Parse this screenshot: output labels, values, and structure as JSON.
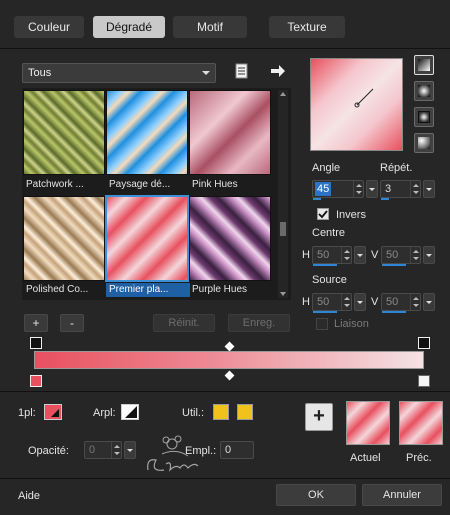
{
  "tabs": [
    {
      "label": "Couleur",
      "active": false
    },
    {
      "label": "Dégradé",
      "active": true
    },
    {
      "label": "Motif",
      "active": false
    },
    {
      "label": "Texture",
      "active": false
    }
  ],
  "category_dropdown": {
    "selected": "Tous"
  },
  "gradients": [
    {
      "name": "Patchwork ...",
      "selected": false
    },
    {
      "name": "Paysage dé...",
      "selected": false
    },
    {
      "name": "Pink Hues",
      "selected": false
    },
    {
      "name": "Polished Co...",
      "selected": false
    },
    {
      "name": "Premier pla...",
      "selected": true
    },
    {
      "name": "Purple Hues",
      "selected": false
    }
  ],
  "list_buttons": {
    "add": "+",
    "remove": "-",
    "reset": "Réinit.",
    "save": "Enreg."
  },
  "angle": {
    "label": "Angle",
    "value": "45"
  },
  "repeat": {
    "label": "Répét.",
    "value": "3"
  },
  "invert": {
    "label": "Invers",
    "checked": true
  },
  "centre": {
    "label": "Centre",
    "h_label": "H",
    "h_value": "50",
    "v_label": "V",
    "v_value": "50"
  },
  "source": {
    "label": "Source",
    "h_label": "H",
    "h_value": "50",
    "v_label": "V",
    "v_value": "50"
  },
  "link": {
    "label": "Liaison",
    "checked": false
  },
  "stops": {
    "first_label": "1pl:",
    "arpl_label": "Arpl:",
    "util_label": "Util.:",
    "opacity_label": "Opacité:",
    "opacity_value": "0",
    "empl_label": "Empl.:",
    "empl_value": "0"
  },
  "preview": {
    "current_label": "Actuel",
    "previous_label": "Préc.",
    "add_symbol": "+"
  },
  "footer": {
    "help": "Aide",
    "ok": "OK",
    "cancel": "Annuler"
  },
  "colors": {
    "pink": "#e8505f",
    "light": "#f2d8da",
    "accent_blue": "#2f86d6",
    "yellow": "#f2c21c"
  },
  "icons": [
    "save-gradient-icon",
    "arrow-right-icon",
    "linear-style-icon",
    "radial-style-icon",
    "rectangular-style-icon",
    "sunburst-style-icon",
    "stop-marker-icon"
  ]
}
